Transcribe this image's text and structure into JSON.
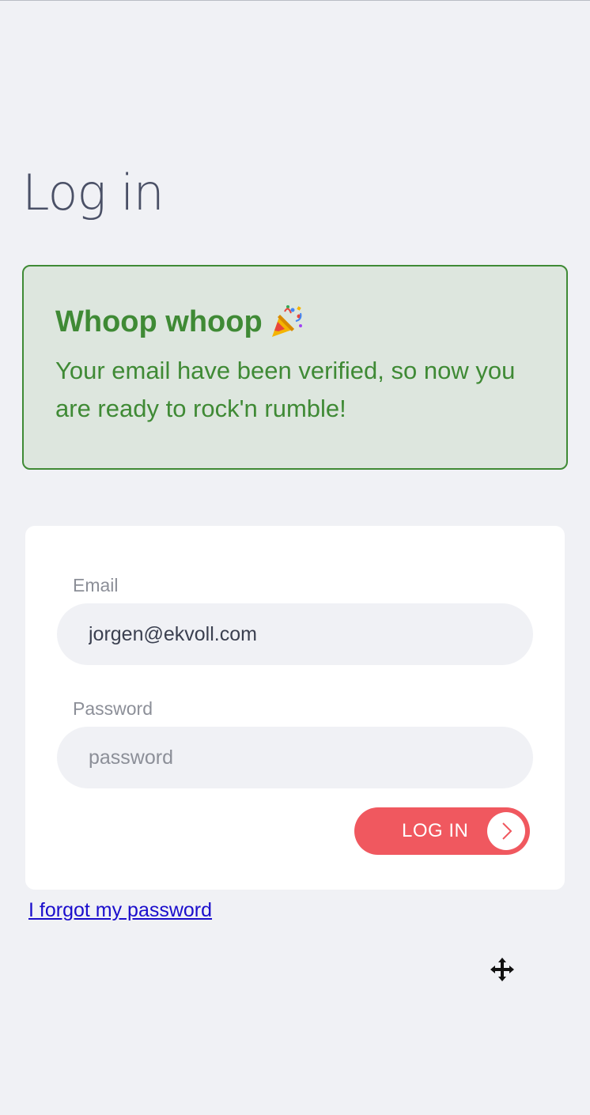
{
  "page": {
    "title": "Log in"
  },
  "alert": {
    "heading": "Whoop whoop",
    "heading_icon": "party-popper-icon",
    "message": "Your email have been verified, so now you are ready to rock'n rumble!",
    "color": "#3f8a35",
    "background": "#dde6de"
  },
  "form": {
    "email_label": "Email",
    "email_value": "jorgen@ekvoll.com",
    "password_label": "Password",
    "password_placeholder": "password",
    "submit_label": "LOG IN",
    "submit_icon": "chevron-right-icon",
    "submit_color": "#f0585f"
  },
  "links": {
    "forgot_password": "I forgot my password"
  },
  "cursor": {
    "icon": "move-cursor-icon"
  }
}
